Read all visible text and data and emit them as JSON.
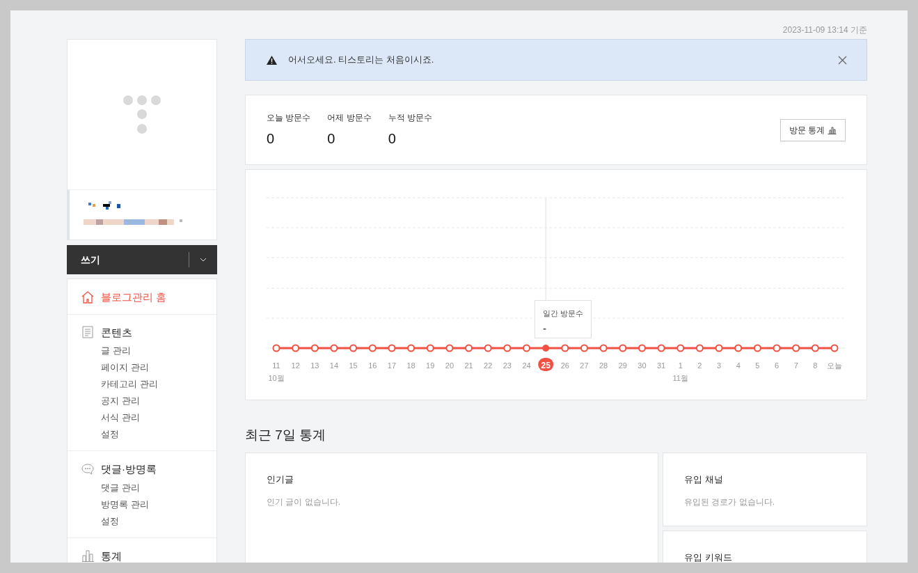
{
  "timestamp": "2023-11-09 13:14 기준",
  "alert": {
    "text": "어서오세요. 티스토리는 처음이시죠."
  },
  "sidebar": {
    "write_button": "쓰기",
    "menu": [
      {
        "title": "블로그관리 홈",
        "kind": "home",
        "selected": true
      },
      {
        "title": "콘텐츠",
        "kind": "document",
        "selected": false,
        "children": [
          "글 관리",
          "페이지 관리",
          "카테고리 관리",
          "공지 관리",
          "서식 관리",
          "설정"
        ]
      },
      {
        "title": "댓글·방명록",
        "kind": "comment",
        "selected": false,
        "children": [
          "댓글 관리",
          "방명록 관리",
          "설정"
        ]
      },
      {
        "title": "통계",
        "kind": "chart",
        "selected": false
      }
    ]
  },
  "stats": [
    {
      "label": "오늘 방문수",
      "value": "0"
    },
    {
      "label": "어제 방문수",
      "value": "0"
    },
    {
      "label": "누적 방문수",
      "value": "0"
    }
  ],
  "stats_button": "방문 통계",
  "chart": {
    "x_labels": [
      {
        "day": "11",
        "month": "10월",
        "selected": false
      },
      {
        "day": "12",
        "selected": false
      },
      {
        "day": "13",
        "selected": false
      },
      {
        "day": "14",
        "selected": false
      },
      {
        "day": "15",
        "selected": false
      },
      {
        "day": "16",
        "selected": false
      },
      {
        "day": "17",
        "selected": false
      },
      {
        "day": "18",
        "selected": false
      },
      {
        "day": "19",
        "selected": false
      },
      {
        "day": "20",
        "selected": false
      },
      {
        "day": "21",
        "selected": false
      },
      {
        "day": "22",
        "selected": false
      },
      {
        "day": "23",
        "selected": false
      },
      {
        "day": "24",
        "selected": false
      },
      {
        "day": "25",
        "selected": true
      },
      {
        "day": "26",
        "selected": false
      },
      {
        "day": "27",
        "selected": false
      },
      {
        "day": "28",
        "selected": false
      },
      {
        "day": "29",
        "selected": false
      },
      {
        "day": "30",
        "selected": false
      },
      {
        "day": "31",
        "selected": false
      },
      {
        "day": "1",
        "month": "11월",
        "selected": false
      },
      {
        "day": "2",
        "selected": false
      },
      {
        "day": "3",
        "selected": false
      },
      {
        "day": "4",
        "selected": false
      },
      {
        "day": "5",
        "selected": false
      },
      {
        "day": "6",
        "selected": false
      },
      {
        "day": "7",
        "selected": false
      },
      {
        "day": "8",
        "selected": false
      },
      {
        "day": "오늘",
        "selected": false
      }
    ],
    "tooltip": {
      "title": "일간 방문수",
      "value": "-"
    }
  },
  "recent": {
    "heading": "최근 7일 통계",
    "panels": [
      {
        "title": "인기글",
        "empty_text": "인기 글이 없습니다."
      },
      {
        "title": "유입 채널",
        "empty_text": "유입된 경로가 없습니다."
      },
      {
        "title": "유입 키워드"
      }
    ]
  }
}
